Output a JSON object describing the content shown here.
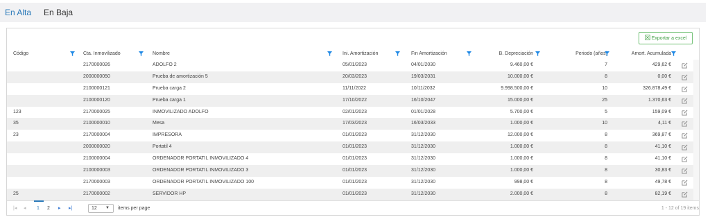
{
  "tabs": [
    {
      "label": "En Alta",
      "active": true
    },
    {
      "label": "En Baja",
      "active": false
    }
  ],
  "toolbar": {
    "export_label": "Exportar a excel"
  },
  "columns": [
    "Código",
    "Cta. Inmovilizado",
    "Nombre",
    "Ini. Amortización",
    "Fin Amortización",
    "B. Depreciación",
    "Periodo (años)",
    "Amort. Acumulada"
  ],
  "rows": [
    {
      "codigo": "",
      "cta": "2170000026",
      "nombre": "ADOLFO 2",
      "ini": "05/01/2023",
      "fin": "04/01/2030",
      "base": "9.460,00 €",
      "periodo": "7",
      "acum": "429,62 €"
    },
    {
      "codigo": "",
      "cta": "2000000050",
      "nombre": "Prueba de amortización 5",
      "ini": "20/03/2023",
      "fin": "19/03/2031",
      "base": "10.000,00 €",
      "periodo": "8",
      "acum": "0,00 €"
    },
    {
      "codigo": "",
      "cta": "2100000121",
      "nombre": "Prueba carga 2",
      "ini": "11/11/2022",
      "fin": "10/11/2032",
      "base": "9.998.500,00 €",
      "periodo": "10",
      "acum": "326.878,49 €"
    },
    {
      "codigo": "",
      "cta": "2100000120",
      "nombre": "Prueba carga 1",
      "ini": "17/10/2022",
      "fin": "16/10/2047",
      "base": "15.000,00 €",
      "periodo": "25",
      "acum": "1.370,63 €"
    },
    {
      "codigo": "123",
      "cta": "2170000025",
      "nombre": "INMOVILIZADO ADOLFO",
      "ini": "02/01/2023",
      "fin": "01/01/2028",
      "base": "5.700,00 €",
      "periodo": "5",
      "acum": "159,09 €"
    },
    {
      "codigo": "35",
      "cta": "2100000010",
      "nombre": "Mesa",
      "ini": "17/03/2023",
      "fin": "16/03/2033",
      "base": "1.000,00 €",
      "periodo": "10",
      "acum": "4,11 €"
    },
    {
      "codigo": "23",
      "cta": "2170000004",
      "nombre": "IMPRESORA",
      "ini": "01/01/2023",
      "fin": "31/12/2030",
      "base": "12.000,00 €",
      "periodo": "8",
      "acum": "369,87 €"
    },
    {
      "codigo": "",
      "cta": "2000000020",
      "nombre": "Portatil 4",
      "ini": "01/01/2023",
      "fin": "31/12/2030",
      "base": "1.000,00 €",
      "periodo": "8",
      "acum": "41,10 €"
    },
    {
      "codigo": "",
      "cta": "2100000004",
      "nombre": "ORDENADOR PORTATIL INMOVILIZADO 4",
      "ini": "01/01/2023",
      "fin": "31/12/2030",
      "base": "1.000,00 €",
      "periodo": "8",
      "acum": "41,10 €"
    },
    {
      "codigo": "",
      "cta": "2100000003",
      "nombre": "ORDENADOR PORTATIL INMOVILIZADO 3",
      "ini": "01/01/2023",
      "fin": "31/12/2030",
      "base": "1.000,00 €",
      "periodo": "8",
      "acum": "30,83 €"
    },
    {
      "codigo": "",
      "cta": "2170000003",
      "nombre": "ORDENADOR PORTATIL INMOVILIZADO 100",
      "ini": "01/01/2023",
      "fin": "31/12/2030",
      "base": "998,00 €",
      "periodo": "8",
      "acum": "49,78 €"
    },
    {
      "codigo": "25",
      "cta": "2170000002",
      "nombre": "SERVIDOR HP",
      "ini": "01/01/2023",
      "fin": "31/12/2030",
      "base": "2.000,00 €",
      "periodo": "8",
      "acum": "82,19 €"
    }
  ],
  "pager": {
    "first_icon": "first-page-icon",
    "prev_icon": "previous-page-icon",
    "pages": [
      "1",
      "2"
    ],
    "current_page": "1",
    "next_icon": "next-page-icon",
    "last_icon": "last-page-icon",
    "page_size": "12",
    "items_per_page_label": "items per page",
    "range_text": "1 - 12 of 19 items"
  },
  "colors": {
    "accent": "#2979b9",
    "filter_icon": "#1e88e5",
    "export_green": "#43a047",
    "row_stripe": "#efefef"
  }
}
